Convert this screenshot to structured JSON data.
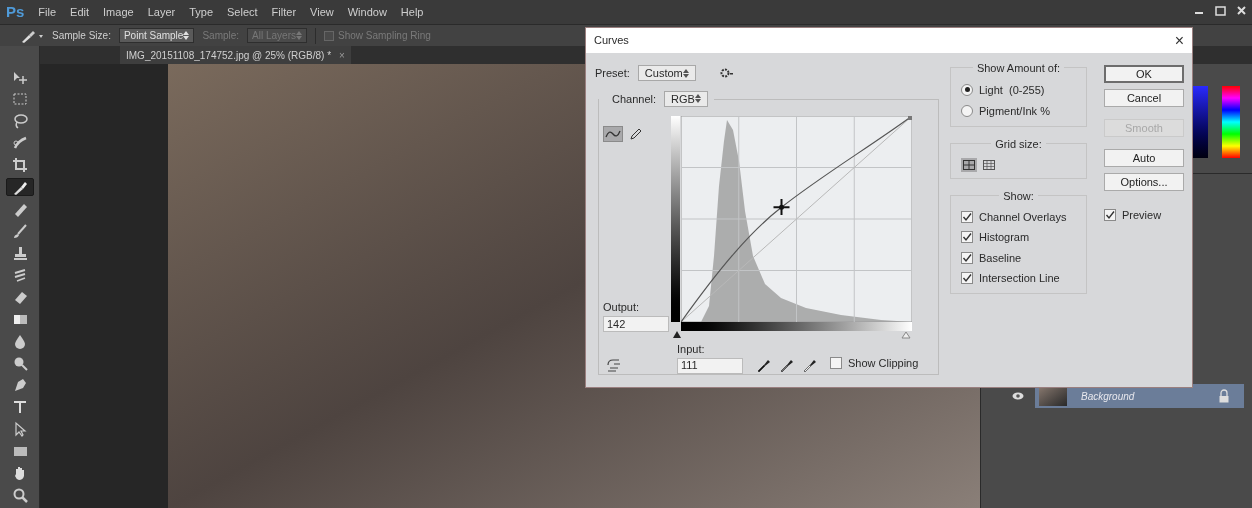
{
  "menu_bar": {
    "logo": "Ps",
    "items": [
      "File",
      "Edit",
      "Image",
      "Layer",
      "Type",
      "Select",
      "Filter",
      "View",
      "Window",
      "Help"
    ]
  },
  "options_bar": {
    "sample_size": {
      "label": "Sample Size:",
      "value": "Point Sample",
      "disabled": false
    },
    "sample": {
      "label": "Sample:",
      "value": "All Layers",
      "disabled": true
    },
    "show_sampling_ring": {
      "label": "Show Sampling Ring",
      "checked": false,
      "disabled": true
    }
  },
  "document_tab": {
    "title": "IMG_20151108_174752.jpg @ 25% (RGB/8) *",
    "close": "×"
  },
  "tools": [
    {
      "kind": "move",
      "selected": false
    },
    {
      "kind": "marquee",
      "selected": false
    },
    {
      "kind": "lasso",
      "selected": false
    },
    {
      "kind": "quick-select",
      "selected": false
    },
    {
      "kind": "crop",
      "selected": false
    },
    {
      "kind": "eyedropper",
      "selected": true
    },
    {
      "kind": "healing",
      "selected": false
    },
    {
      "kind": "brush",
      "selected": false
    },
    {
      "kind": "stamp",
      "selected": false
    },
    {
      "kind": "history",
      "selected": false
    },
    {
      "kind": "eraser",
      "selected": false
    },
    {
      "kind": "gradient",
      "selected": false
    },
    {
      "kind": "drop",
      "selected": false
    },
    {
      "kind": "dodge",
      "selected": false
    },
    {
      "kind": "pen",
      "selected": false
    },
    {
      "kind": "type",
      "selected": false
    },
    {
      "kind": "path-select",
      "selected": false
    },
    {
      "kind": "shape",
      "selected": false
    },
    {
      "kind": "hand",
      "selected": false
    },
    {
      "kind": "zoom",
      "selected": false
    }
  ],
  "curves_dialog": {
    "title": "Curves",
    "close": "×",
    "preset": {
      "label": "Preset:",
      "value": "Custom"
    },
    "channel": {
      "label": "Channel:",
      "value": "RGB"
    },
    "curve_tools": [
      {
        "kind": "curve",
        "selected": true
      },
      {
        "kind": "pencil",
        "selected": false
      }
    ],
    "output": {
      "label": "Output:",
      "value": "142"
    },
    "input": {
      "label": "Input:",
      "value": "111"
    },
    "show_clipping": {
      "label": "Show Clipping",
      "checked": false
    },
    "show_amount": {
      "title": "Show Amount of:",
      "options": [
        {
          "label": "Light  (0-255)",
          "selected": true
        },
        {
          "label": "Pigment/Ink %",
          "selected": false
        }
      ]
    },
    "grid_size": {
      "title": "Grid size:",
      "options": [
        {
          "kind": "coarse",
          "selected": true
        },
        {
          "kind": "fine",
          "selected": false
        }
      ]
    },
    "show": {
      "title": "Show:",
      "items": [
        {
          "label": "Channel Overlays",
          "checked": true
        },
        {
          "label": "Histogram",
          "checked": true
        },
        {
          "label": "Baseline",
          "checked": true
        },
        {
          "label": "Intersection Line",
          "checked": true
        }
      ]
    },
    "buttons": [
      {
        "label": "OK",
        "disabled": false,
        "default": true
      },
      {
        "label": "Cancel",
        "disabled": false,
        "default": false
      },
      {
        "label": "Smooth",
        "disabled": true,
        "default": false
      },
      {
        "label": "Auto",
        "disabled": false,
        "default": false
      },
      {
        "label": "Options...",
        "disabled": false,
        "default": false
      }
    ],
    "preview": {
      "label": "Preview",
      "checked": true
    }
  },
  "layers": [
    {
      "name": "Background",
      "visible": true,
      "locked": true
    }
  ]
}
